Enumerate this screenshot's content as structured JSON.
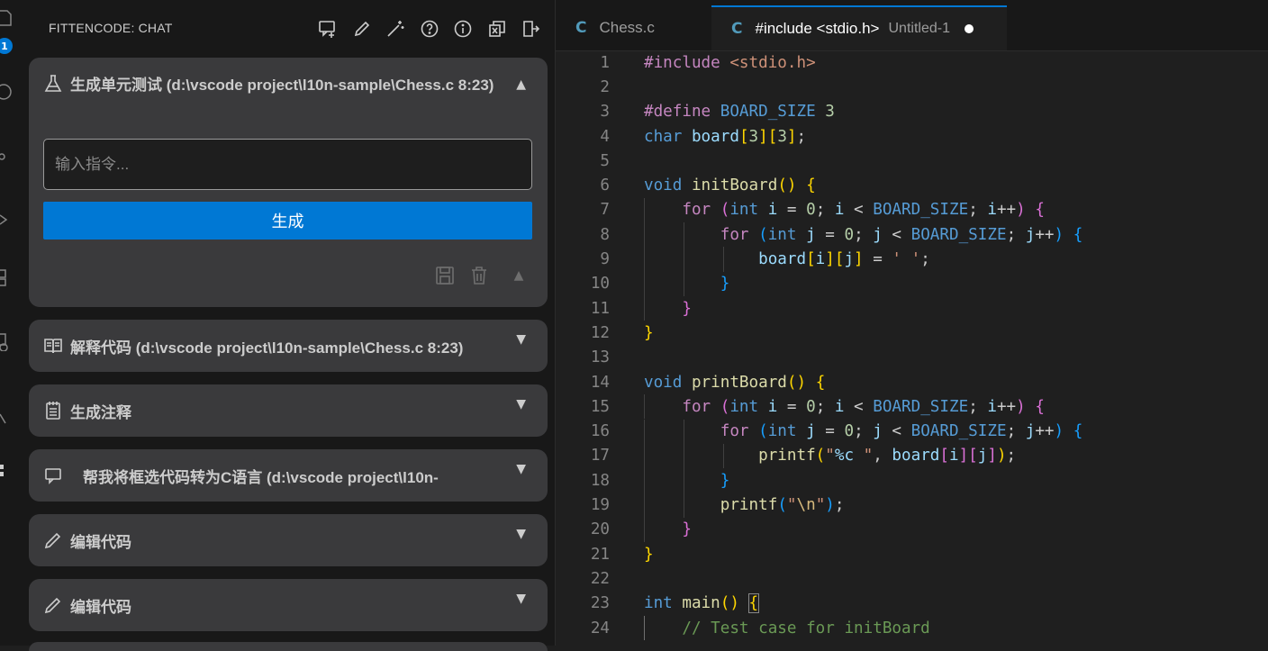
{
  "activity_bar": {
    "badge_count": "1",
    "icons": [
      "explorer-icon",
      "search-icon",
      "source-control-icon",
      "run-debug-icon",
      "extensions-icon",
      "remote-icon",
      "testing-icon",
      "fittencode-icon"
    ]
  },
  "sidebar": {
    "title": "FITTENCODE: CHAT",
    "actions": [
      "new-chat-icon",
      "edit-icon",
      "magic-wand-icon",
      "help-icon",
      "info-icon",
      "copy-icon",
      "logout-icon"
    ],
    "main_card": {
      "title": "生成单元测试 (d:\\vscode project\\l10n-sample\\Chess.c 8:23)",
      "toggle": "▲",
      "input_placeholder": "输入指令...",
      "generate_label": "生成",
      "tool_toggle": "▲"
    },
    "cards": [
      {
        "title": "解释代码 (d:\\vscode project\\l10n-sample\\Chess.c 8:23)",
        "toggle": "▼",
        "icon": "book-icon"
      },
      {
        "title": "生成注释",
        "toggle": "▼",
        "icon": "notes-icon"
      },
      {
        "title": "帮我将框选代码转为C语言  (d:\\vscode project\\l10n-",
        "toggle": "▼",
        "icon": "chat-icon"
      },
      {
        "title": "编辑代码",
        "toggle": "▼",
        "icon": "pencil-icon"
      },
      {
        "title": "编辑代码",
        "toggle": "▼",
        "icon": "pencil-icon"
      }
    ]
  },
  "editor": {
    "tabs": [
      {
        "icon": "C",
        "label": "Chess.c"
      },
      {
        "icon": "C",
        "label": "#include <stdio.h>",
        "sub": "Untitled-1",
        "dirty": true
      }
    ],
    "line_numbers": [
      "1",
      "2",
      "3",
      "4",
      "5",
      "6",
      "7",
      "8",
      "9",
      "10",
      "11",
      "12",
      "13",
      "14",
      "15",
      "16",
      "17",
      "18",
      "19",
      "20",
      "21",
      "22",
      "23",
      "24"
    ]
  },
  "colors": {
    "accent": "#0078d4",
    "card": "#3a3a3c",
    "sidebar": "#181818",
    "editor": "#1f1f1f"
  }
}
